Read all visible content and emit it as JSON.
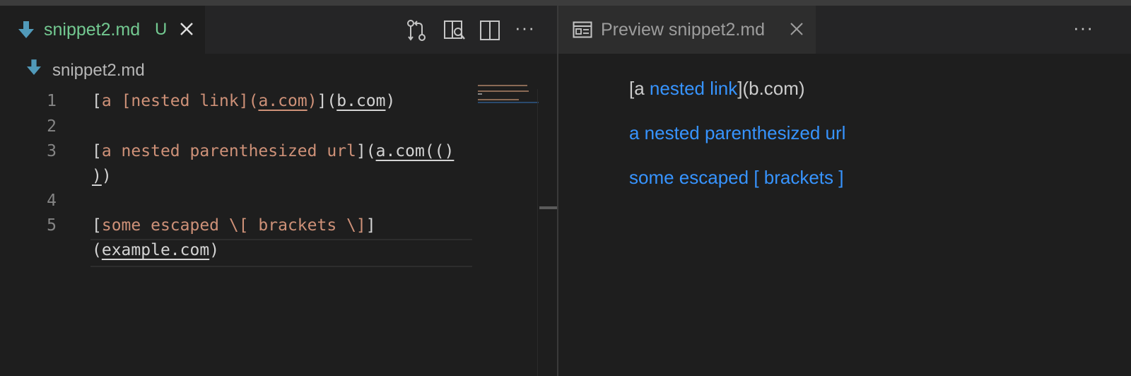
{
  "editor": {
    "tab": {
      "filename": "snippet2.md",
      "status": "U"
    },
    "breadcrumb": "snippet2.md",
    "lines": {
      "n1": "1",
      "n2": "2",
      "n3": "3",
      "n4": "4",
      "n5": "5",
      "l1": {
        "a": "[",
        "b": "a ",
        "c": "[nested link](",
        "d": "a.com",
        "e": ")",
        "f": "](",
        "g": "b.com",
        "h": ")"
      },
      "l3": {
        "a": "[",
        "b": "a nested parenthesized url",
        "c": "](",
        "d": "a.com(()"
      },
      "l3w": {
        "a": ")",
        "b": ")"
      },
      "l5": {
        "a": "[",
        "b": "some escaped \\[ brackets \\]",
        "c": "]"
      },
      "l5w": {
        "a": "(",
        "b": "example.com",
        "c": ")"
      }
    },
    "more": "···"
  },
  "preview": {
    "tab": {
      "label": "Preview snippet2.md"
    },
    "more": "···",
    "p1": {
      "a": "[a ",
      "b": "nested link",
      "c": "](b.com)"
    },
    "p2": "a nested parenthesized url",
    "p3": "some escaped [ brackets ]"
  },
  "colors": {
    "modified_file": "#73c991",
    "link": "#3794ff",
    "string": "#ce9178"
  }
}
